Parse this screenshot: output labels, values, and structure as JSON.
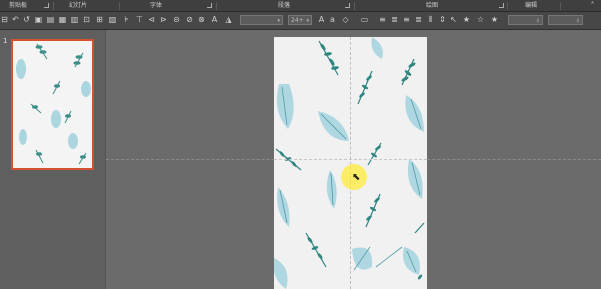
{
  "ribbon": {
    "groups": [
      {
        "label": "剪贴板"
      },
      {
        "label": "幻灯片"
      },
      {
        "label": "字体"
      },
      {
        "label": "段落"
      },
      {
        "label": "绘图"
      },
      {
        "label": "编辑"
      }
    ]
  },
  "toolbar": {
    "font_size_value": "24+"
  },
  "slides_panel": {
    "slide_number": "1"
  },
  "colors": {
    "leaf_dark": "#3d8e8a",
    "leaf_light": "#9fd0dc",
    "selection_border": "#d4512f",
    "cursor_highlight": "#ffeb3b"
  }
}
